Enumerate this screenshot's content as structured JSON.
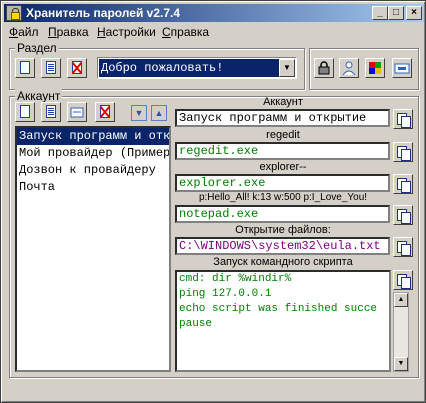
{
  "window": {
    "title": "Хранитель паролей v2.7.4"
  },
  "menubar": {
    "items": [
      {
        "first": "Ф",
        "rest": "айл"
      },
      {
        "first": "П",
        "rest": "равка"
      },
      {
        "first": "Н",
        "rest": "астройки"
      },
      {
        "first": "С",
        "rest": "правка"
      }
    ]
  },
  "section": {
    "legend": "Раздел",
    "selected": "Добро пожаловать!"
  },
  "account": {
    "legend": "Аккаунт",
    "items": [
      "Запуск программ и откр",
      "Мой провайдер (Пример)",
      "Дозвон к провайдеру",
      "Почта"
    ],
    "selected_index": 0
  },
  "details": {
    "header": "Аккаунт",
    "name": "Запуск программ и открытие",
    "label_1": "regedit",
    "value_1": "regedit.exe",
    "label_2": "explorer--",
    "value_2": "explorer.exe",
    "label_3": "p:Hello_All! k:13 w:500 p:I_Love_You!",
    "value_3": "notepad.exe",
    "label_4": "Открытие файлов:",
    "value_4": "C:\\WINDOWS\\system32\\eula.txt",
    "label_5": "Запуск командного скрипта",
    "script_lines": [
      "cmd: dir %windir%",
      "ping 127.0.0.1",
      "echo script was finished succe",
      "pause"
    ]
  },
  "colors": {
    "green_text": "#008000",
    "purple_text": "#800080",
    "selection": "#0a246a"
  },
  "icons": {
    "new": "new-document-icon",
    "edit": "edit-document-icon",
    "delete": "delete-document-icon",
    "lock": "lock-icon",
    "user": "user-icon",
    "palette": "palette-icon",
    "settings": "settings-icon",
    "copy": "copy-icon",
    "up": "arrow-up-icon",
    "down": "arrow-down-icon"
  }
}
